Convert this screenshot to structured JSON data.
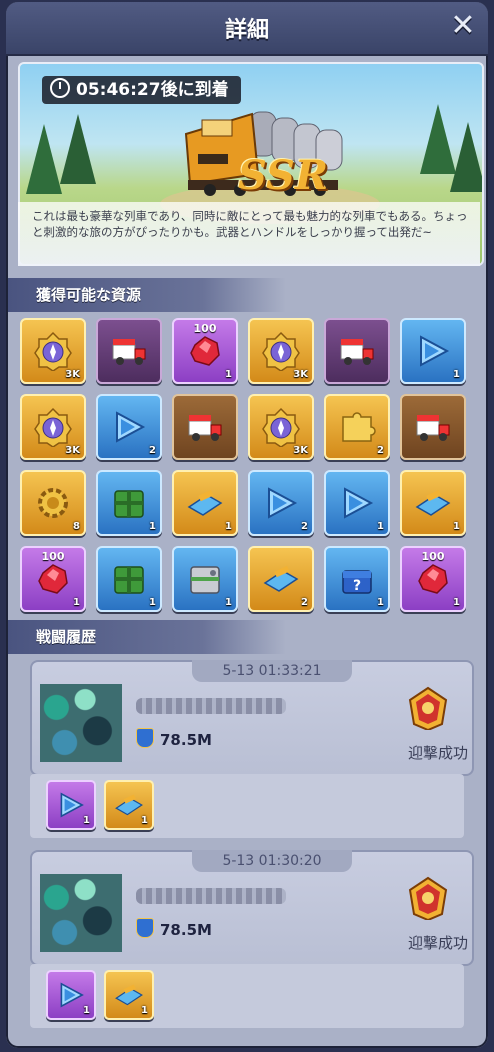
{
  "window": {
    "title": "詳細",
    "close_label": "✕"
  },
  "banner": {
    "timer": "05:46:27後に到着",
    "rarity": "SSR",
    "description": "これは最も豪華な列車であり、同時に敵にとって最も魅力的な列車でもある。ちょっと刺激的な旅の方がぴったりかも。武器とハンドルをしっかり握って出発だ~"
  },
  "resources": {
    "header": "獲得可能な資源",
    "items": [
      {
        "icon": "compass-icon",
        "bg": "gold",
        "qty": "3K",
        "top": ""
      },
      {
        "icon": "truck-icon",
        "bg": "dpurple",
        "qty": "",
        "top": ""
      },
      {
        "icon": "ruby-icon",
        "bg": "purple",
        "qty": "1",
        "top": "100"
      },
      {
        "icon": "compass-icon",
        "bg": "gold",
        "qty": "3K",
        "top": ""
      },
      {
        "icon": "truck-icon",
        "bg": "dpurple",
        "qty": "",
        "top": ""
      },
      {
        "icon": "play-icon",
        "bg": "blue",
        "qty": "1",
        "top": ""
      },
      {
        "icon": "compass-icon",
        "bg": "gold",
        "qty": "3K",
        "top": ""
      },
      {
        "icon": "play-icon",
        "bg": "blue",
        "qty": "2",
        "top": ""
      },
      {
        "icon": "truck-icon",
        "bg": "brown",
        "qty": "",
        "top": ""
      },
      {
        "icon": "compass-icon",
        "bg": "gold",
        "qty": "3K",
        "top": ""
      },
      {
        "icon": "puzzle-icon",
        "bg": "gold",
        "qty": "2",
        "top": ""
      },
      {
        "icon": "truck-icon",
        "bg": "brown",
        "qty": "",
        "top": ""
      },
      {
        "icon": "gear-icon",
        "bg": "gold",
        "qty": "8",
        "top": ""
      },
      {
        "icon": "green-crate-icon",
        "bg": "blue",
        "qty": "1",
        "top": ""
      },
      {
        "icon": "blueprint-icon",
        "bg": "gold",
        "qty": "1",
        "top": ""
      },
      {
        "icon": "play-icon",
        "bg": "blue",
        "qty": "2",
        "top": ""
      },
      {
        "icon": "play-icon",
        "bg": "blue",
        "qty": "1",
        "top": ""
      },
      {
        "icon": "blueprint-icon",
        "bg": "gold",
        "qty": "1",
        "top": ""
      },
      {
        "icon": "ruby-icon",
        "bg": "purple",
        "qty": "1",
        "top": "100"
      },
      {
        "icon": "green-crate-icon",
        "bg": "blue",
        "qty": "1",
        "top": ""
      },
      {
        "icon": "gray-crate-icon",
        "bg": "blue",
        "qty": "1",
        "top": ""
      },
      {
        "icon": "blueprint-icon",
        "bg": "gold",
        "qty": "2",
        "top": ""
      },
      {
        "icon": "mystery-chest-icon",
        "bg": "blue",
        "qty": "1",
        "top": ""
      },
      {
        "icon": "ruby-icon",
        "bg": "purple",
        "qty": "1",
        "top": "100"
      }
    ]
  },
  "battles": {
    "header": "戦闘履歴",
    "records": [
      {
        "time": "5-13 01:33:21",
        "power": "78.5M",
        "result": "迎撃成功",
        "rewards": [
          {
            "icon": "play-icon",
            "bg": "purple",
            "qty": "1"
          },
          {
            "icon": "blueprint-icon",
            "bg": "gold",
            "qty": "1"
          }
        ]
      },
      {
        "time": "5-13 01:30:20",
        "power": "78.5M",
        "result": "迎撃成功",
        "rewards": [
          {
            "icon": "play-icon",
            "bg": "purple",
            "qty": "1"
          },
          {
            "icon": "blueprint-icon",
            "bg": "gold",
            "qty": "1"
          }
        ]
      }
    ]
  }
}
